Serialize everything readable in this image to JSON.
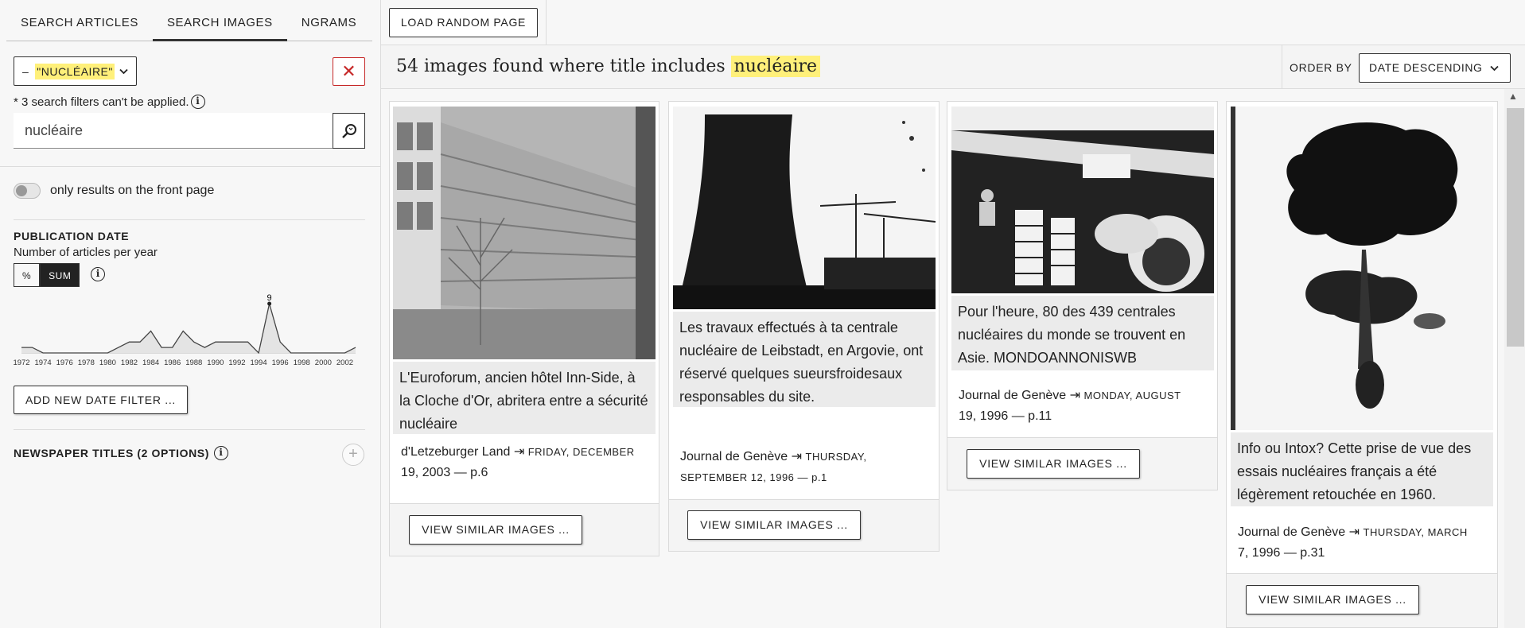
{
  "tabs": [
    "SEARCH ARTICLES",
    "SEARCH IMAGES",
    "NGRAMS"
  ],
  "filter": {
    "minus": "–",
    "term": "\"NUCLÉAIRE\"",
    "clear": "✕"
  },
  "note": "* 3 search filters can't be applied.",
  "search": {
    "value": "nucléaire",
    "placeholder": ""
  },
  "front_page_toggle": "only results on the front page",
  "publication_date": {
    "title": "PUBLICATION DATE",
    "subtitle": "Number of articles per year",
    "modes": [
      "%",
      "SUM"
    ],
    "active_mode": "SUM",
    "add_filter": "ADD NEW DATE FILTER ..."
  },
  "chart_data": {
    "type": "area",
    "x": [
      1972,
      1973,
      1974,
      1975,
      1976,
      1977,
      1978,
      1979,
      1980,
      1981,
      1982,
      1983,
      1984,
      1985,
      1986,
      1987,
      1988,
      1989,
      1990,
      1991,
      1992,
      1993,
      1994,
      1995,
      1996,
      1997,
      1998,
      1999,
      2000,
      2001,
      2002,
      2003
    ],
    "values": [
      1,
      1,
      0,
      0,
      0,
      0,
      0,
      0,
      0,
      1,
      2,
      2,
      4,
      1,
      1,
      4,
      2,
      1,
      2,
      2,
      2,
      2,
      0,
      9,
      2,
      0,
      0,
      0,
      0,
      0,
      0,
      1
    ],
    "tick_labels": [
      "1972",
      "1974",
      "1976",
      "1978",
      "1980",
      "1982",
      "1984",
      "1986",
      "1988",
      "1990",
      "1992",
      "1994",
      "1996",
      "1998",
      "2000",
      "2002"
    ],
    "annotation": "9",
    "ylim": [
      0,
      9
    ],
    "color": "#444444"
  },
  "newspaper_titles": "NEWSPAPER TITLES (2 OPTIONS)",
  "load_random": "LOAD RANDOM PAGE",
  "results": {
    "prefix": "54 images found where title includes",
    "term": "nucléaire"
  },
  "order": {
    "label": "ORDER BY",
    "value": "DATE DESCENDING"
  },
  "cards": [
    {
      "caption": "L'Euroforum, ancien hôtel Inn-Side, à la Cloche d'Or, abritera entre a sécurité nucléaire",
      "newspaper": "d'Letzeburger Land",
      "date": "FRIDAY, DECEMBER",
      "date2": "19, 2003 — p.6",
      "button": "VIEW SIMILAR IMAGES ..."
    },
    {
      "caption": "Les travaux effectués à ta centrale nucléaire de Leibstadt, en Argovie, ont réservé quelques sueursfroidesaux responsables du site.",
      "newspaper": "Journal de Genève",
      "date": "THURSDAY,",
      "date2": "SEPTEMBER 12, 1996 — p.1",
      "button": "VIEW SIMILAR IMAGES ..."
    },
    {
      "caption": "Pour l'heure, 80 des 439 centrales nucléaires du monde se trouvent en Asie. MONDOANNONISWB",
      "newspaper": "Journal de Genève",
      "date": "MONDAY, AUGUST",
      "date2": "19, 1996 — p.11",
      "button": "VIEW SIMILAR IMAGES ..."
    },
    {
      "caption": "Info ou Intox? Cette prise de vue des essais nucléaires français a été légèrement retouchée en 1960.",
      "newspaper": "Journal de Genève",
      "date": "THURSDAY, MARCH",
      "date2": "7, 1996 — p.31",
      "button": "VIEW SIMILAR IMAGES ..."
    }
  ]
}
